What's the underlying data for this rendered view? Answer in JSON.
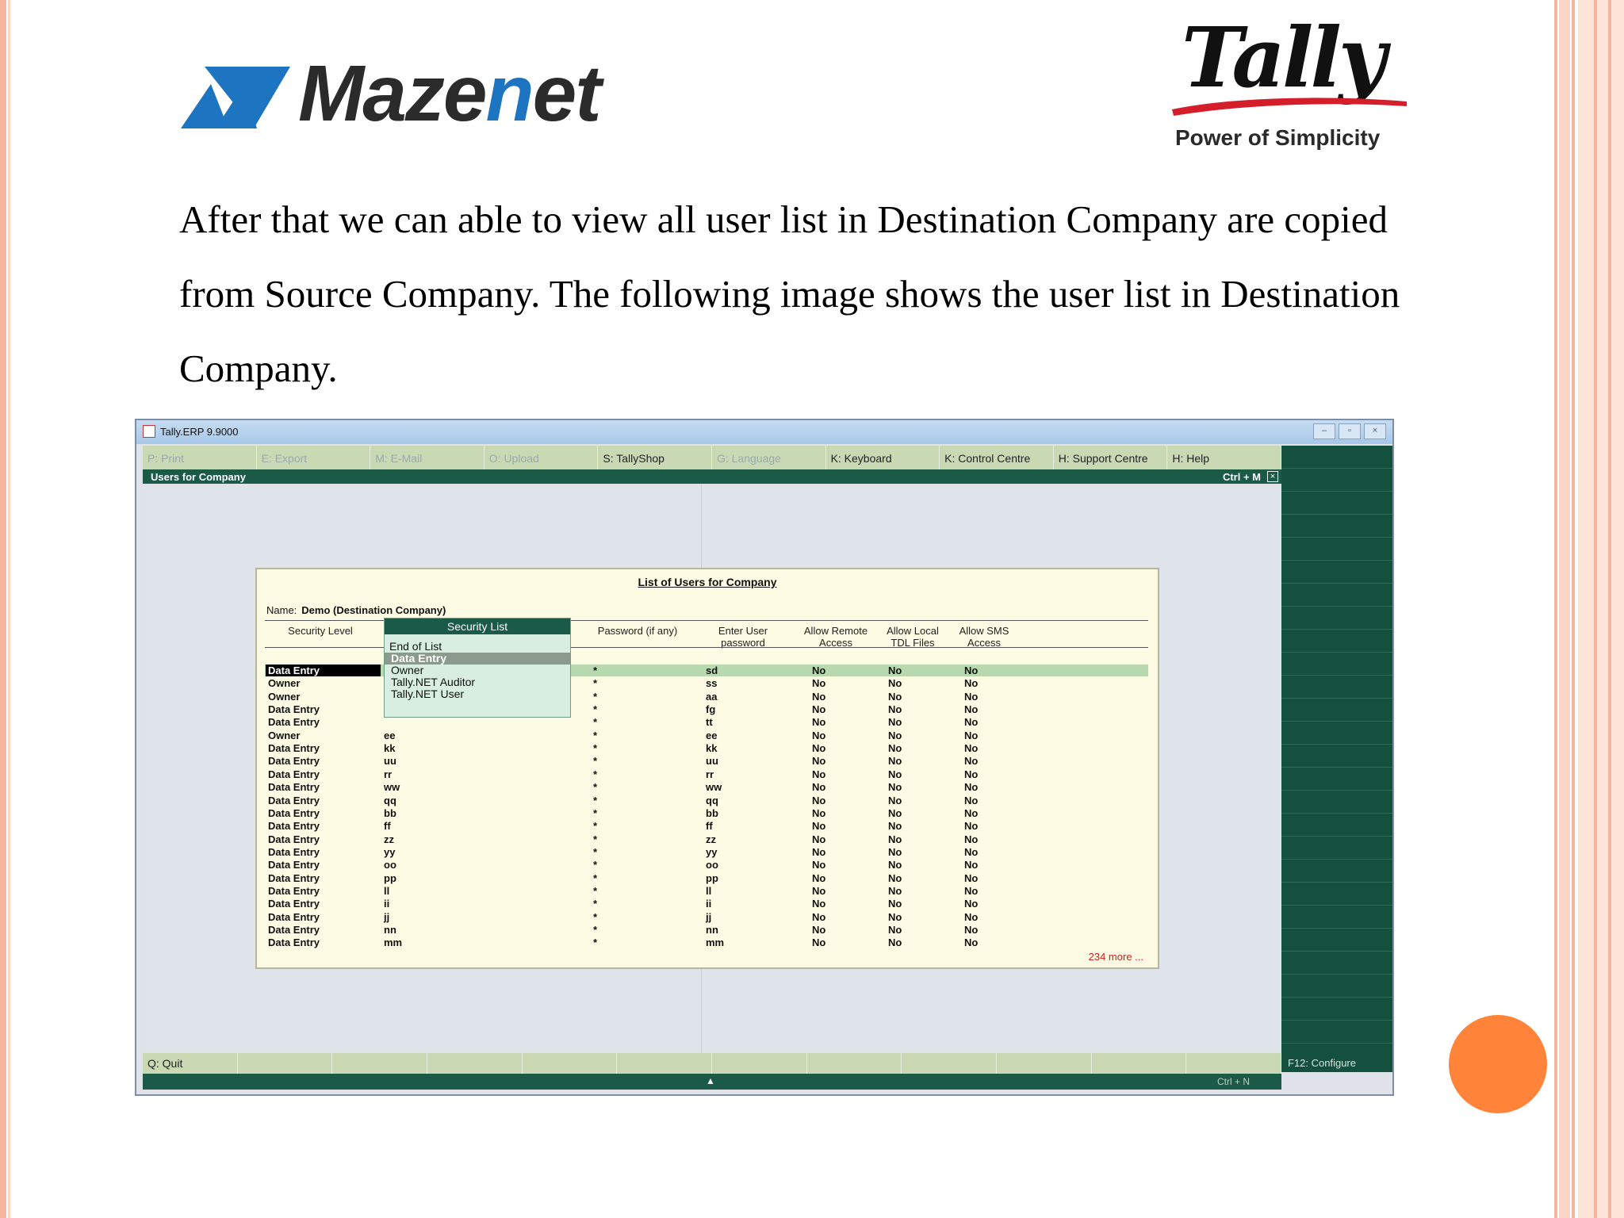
{
  "brand": {
    "mazenet_prefix": "Maze",
    "mazenet_highlight": "n",
    "mazenet_suffix": "et",
    "tally_word": "Tally",
    "tally_tagline": "Power of Simplicity"
  },
  "slide_text": "After that we can able to view all user list in Destination Company are copied from Source Company. The following image shows the user list in Destination Company.",
  "app": {
    "window_title": "Tally.ERP 9.9000",
    "menu": [
      {
        "label": "P: Print",
        "active": false
      },
      {
        "label": "E: Export",
        "active": false
      },
      {
        "label": "M: E-Mail",
        "active": false
      },
      {
        "label": "O: Upload",
        "active": false
      },
      {
        "label": "S: TallyShop",
        "active": true
      },
      {
        "label": "G: Language",
        "active": false
      },
      {
        "label": "K: Keyboard",
        "active": true
      },
      {
        "label": "K: Control Centre",
        "active": true
      },
      {
        "label": "H: Support Centre",
        "active": true
      },
      {
        "label": "H: Help",
        "active": true
      }
    ],
    "header_title": "Users for Company",
    "header_shortcut": "Ctrl + M",
    "bottom_quit": "Q: Quit",
    "side_configure": "F12: Configure",
    "status_shortcut": "Ctrl + N"
  },
  "panel": {
    "title": "List of Users for Company",
    "name_label": "Name:",
    "company_name": "Demo (Destination Company)",
    "columns": {
      "security": "Security Level",
      "password": "Password (if any)",
      "enter_user": "Enter User password",
      "remote": "Allow Remote Access",
      "local": "Allow Local TDL Files",
      "sms": "Allow SMS Access"
    },
    "more_text": "234 more ...",
    "rows": [
      {
        "level": "Data Entry",
        "user": "",
        "pw": "*",
        "enter": "sd",
        "remote": "No",
        "local": "No",
        "sms": "No"
      },
      {
        "level": "Owner",
        "user": "",
        "pw": "*",
        "enter": "ss",
        "remote": "No",
        "local": "No",
        "sms": "No"
      },
      {
        "level": "Owner",
        "user": "",
        "pw": "*",
        "enter": "aa",
        "remote": "No",
        "local": "No",
        "sms": "No"
      },
      {
        "level": "Data Entry",
        "user": "",
        "pw": "*",
        "enter": "fg",
        "remote": "No",
        "local": "No",
        "sms": "No"
      },
      {
        "level": "Data Entry",
        "user": "",
        "pw": "*",
        "enter": "tt",
        "remote": "No",
        "local": "No",
        "sms": "No"
      },
      {
        "level": "Owner",
        "user": "ee",
        "pw": "*",
        "enter": "ee",
        "remote": "No",
        "local": "No",
        "sms": "No"
      },
      {
        "level": "Data Entry",
        "user": "kk",
        "pw": "*",
        "enter": "kk",
        "remote": "No",
        "local": "No",
        "sms": "No"
      },
      {
        "level": "Data Entry",
        "user": "uu",
        "pw": "*",
        "enter": "uu",
        "remote": "No",
        "local": "No",
        "sms": "No"
      },
      {
        "level": "Data Entry",
        "user": "rr",
        "pw": "*",
        "enter": "rr",
        "remote": "No",
        "local": "No",
        "sms": "No"
      },
      {
        "level": "Data Entry",
        "user": "ww",
        "pw": "*",
        "enter": "ww",
        "remote": "No",
        "local": "No",
        "sms": "No"
      },
      {
        "level": "Data Entry",
        "user": "qq",
        "pw": "*",
        "enter": "qq",
        "remote": "No",
        "local": "No",
        "sms": "No"
      },
      {
        "level": "Data Entry",
        "user": "bb",
        "pw": "*",
        "enter": "bb",
        "remote": "No",
        "local": "No",
        "sms": "No"
      },
      {
        "level": "Data Entry",
        "user": "ff",
        "pw": "*",
        "enter": "ff",
        "remote": "No",
        "local": "No",
        "sms": "No"
      },
      {
        "level": "Data Entry",
        "user": "zz",
        "pw": "*",
        "enter": "zz",
        "remote": "No",
        "local": "No",
        "sms": "No"
      },
      {
        "level": "Data Entry",
        "user": "yy",
        "pw": "*",
        "enter": "yy",
        "remote": "No",
        "local": "No",
        "sms": "No"
      },
      {
        "level": "Data Entry",
        "user": "oo",
        "pw": "*",
        "enter": "oo",
        "remote": "No",
        "local": "No",
        "sms": "No"
      },
      {
        "level": "Data Entry",
        "user": "pp",
        "pw": "*",
        "enter": "pp",
        "remote": "No",
        "local": "No",
        "sms": "No"
      },
      {
        "level": "Data Entry",
        "user": "ll",
        "pw": "*",
        "enter": "ll",
        "remote": "No",
        "local": "No",
        "sms": "No"
      },
      {
        "level": "Data Entry",
        "user": "ii",
        "pw": "*",
        "enter": "ii",
        "remote": "No",
        "local": "No",
        "sms": "No"
      },
      {
        "level": "Data Entry",
        "user": "jj",
        "pw": "*",
        "enter": "jj",
        "remote": "No",
        "local": "No",
        "sms": "No"
      },
      {
        "level": "Data Entry",
        "user": "nn",
        "pw": "*",
        "enter": "nn",
        "remote": "No",
        "local": "No",
        "sms": "No"
      },
      {
        "level": "Data Entry",
        "user": "mm",
        "pw": "*",
        "enter": "mm",
        "remote": "No",
        "local": "No",
        "sms": "No"
      }
    ]
  },
  "security_list": {
    "title": "Security List",
    "items": [
      "End of List",
      "Data Entry",
      "Owner",
      "Tally.NET Auditor",
      "Tally.NET User"
    ],
    "selected": "Data Entry"
  },
  "colors": {
    "tally_green": "#1a5a47",
    "menu_bg": "#c9d9b4",
    "panel_bg": "#fdfbe3",
    "accent_orange": "#ff8338",
    "mazenet_blue": "#1d74c1"
  }
}
